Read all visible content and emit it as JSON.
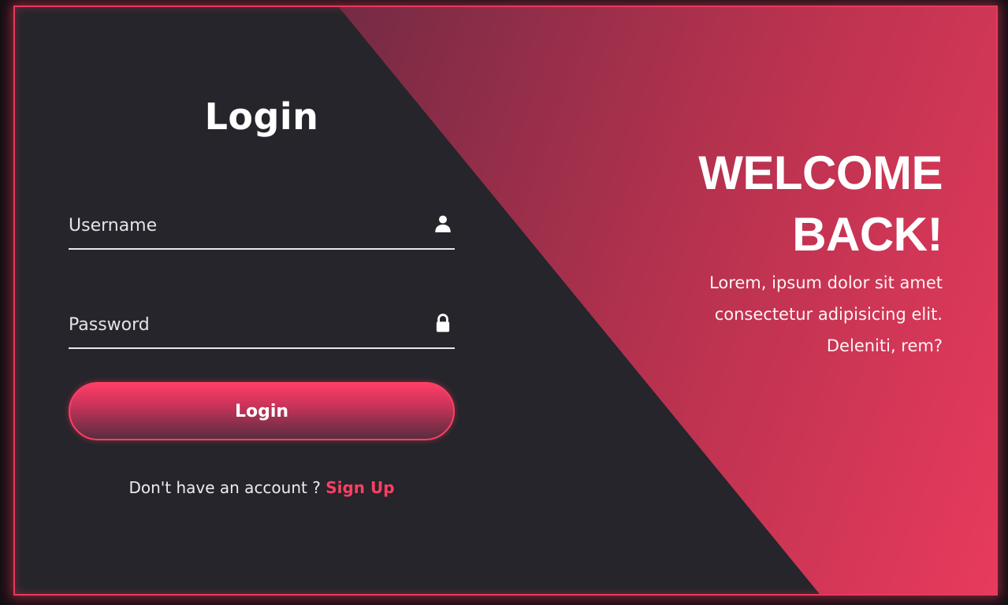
{
  "login": {
    "title": "Login",
    "username_placeholder": "Username",
    "password_placeholder": "Password",
    "button_label": "Login",
    "no_account_text": "Don't have an account ?",
    "signup_link": "Sign Up"
  },
  "welcome": {
    "heading": "WELCOME BACK!",
    "body": "Lorem, ipsum dolor sit amet consectetur adipisicing elit. Deleniti, rem?"
  },
  "icons": {
    "username": "user-icon",
    "password": "lock-icon"
  },
  "colors": {
    "accent": "#ff3f64",
    "panel_dark": "#25252b",
    "gradient_end": "#e83a5c"
  }
}
